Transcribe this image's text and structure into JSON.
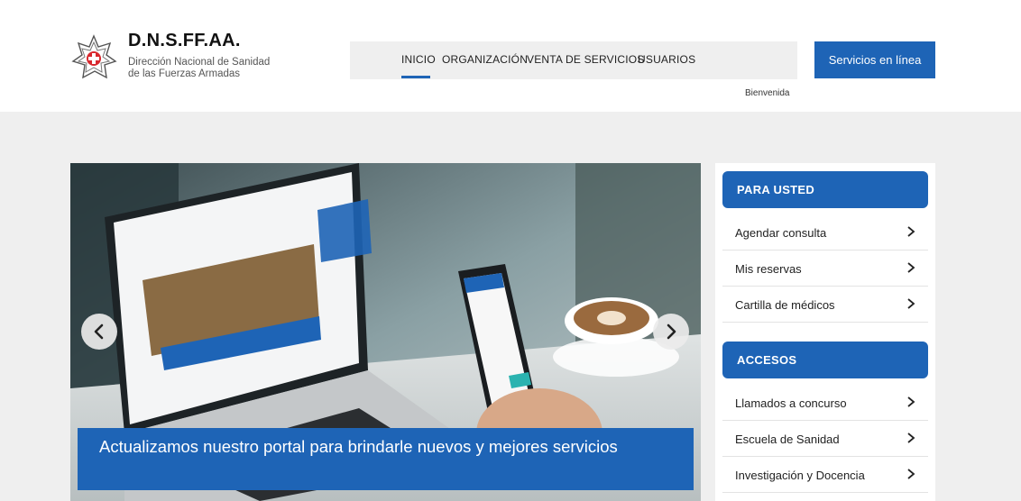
{
  "header": {
    "brand_title": "D.N.S.FF.AA.",
    "brand_subtitle_1": "Dirección Nacional de Sanidad",
    "brand_subtitle_2": "de las Fuerzas Armadas",
    "nav": [
      "INICIO",
      "ORGANIZACIÓN",
      "VENTA DE SERVICIOS",
      "USUARIOS"
    ],
    "online_button": "Servicios en línea",
    "welcome": "Bienvenida"
  },
  "hero": {
    "caption": "Actualizamos nuestro portal para brindarle nuevos y mejores servicios",
    "prev_icon": "chevron-left-icon",
    "next_icon": "chevron-right-icon"
  },
  "sidebar": {
    "sections": [
      {
        "title": "PARA USTED",
        "items": [
          "Agendar consulta",
          "Mis reservas",
          "Cartilla de médicos"
        ]
      },
      {
        "title": "ACCESOS",
        "items": [
          "Llamados a concurso",
          "Escuela de Sanidad",
          "Investigación y Docencia"
        ]
      }
    ]
  },
  "colors": {
    "primary": "#1e64b6",
    "background": "#efefef",
    "accent_red": "#d8282e"
  }
}
